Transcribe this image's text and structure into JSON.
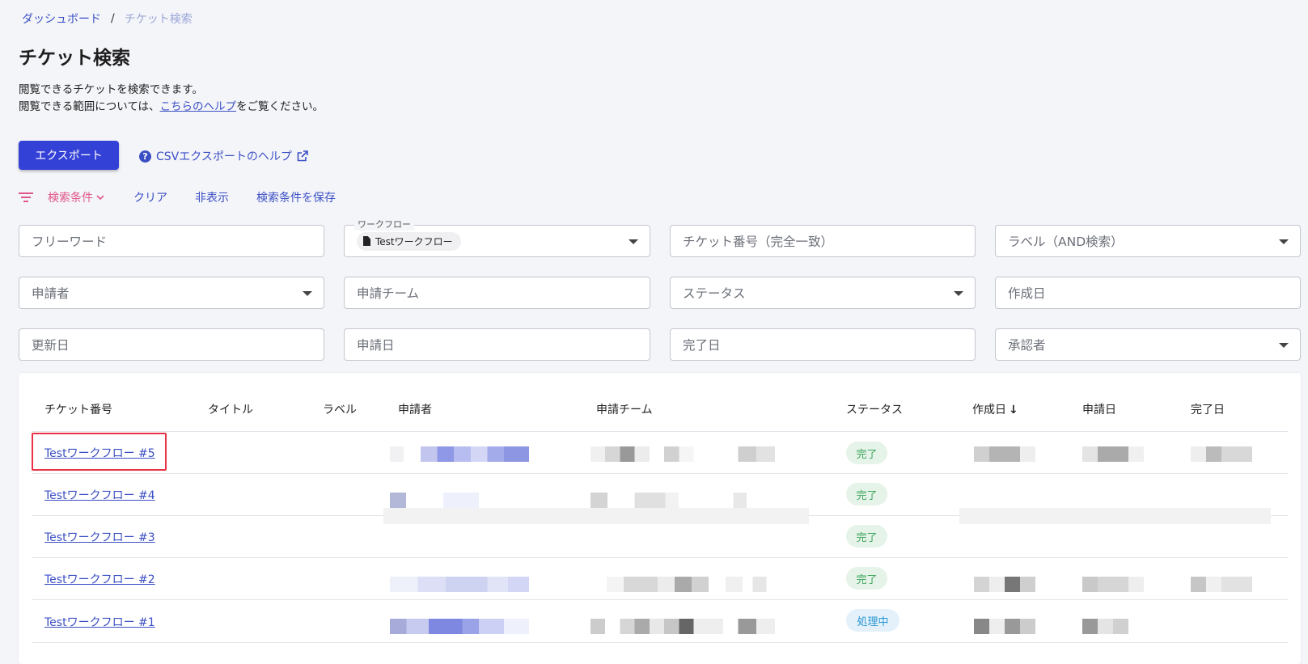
{
  "breadcrumb": {
    "home": "ダッシュボード",
    "separator": "/",
    "current": "チケット検索"
  },
  "page": {
    "title": "チケット検索",
    "desc_line1": "閲覧できるチケットを検索できます。",
    "desc_line2_pre": "閲覧できる範囲については、",
    "desc_line2_link": "こちらのヘルプ",
    "desc_line2_post": "をご覧ください。"
  },
  "toolbar": {
    "export_label": "エクスポート",
    "csv_help_label": "CSVエクスポートのヘルプ"
  },
  "filter_bar": {
    "conditions": "検索条件",
    "clear": "クリア",
    "hide": "非表示",
    "save": "検索条件を保存"
  },
  "fields": {
    "freeword": "フリーワード",
    "workflow_legend": "ワークフロー",
    "workflow_value": "Testワークフロー",
    "ticket_number": "チケット番号（完全一致）",
    "label": "ラベル（AND検索）",
    "applicant": "申請者",
    "applicant_team": "申請チーム",
    "status": "ステータス",
    "created_date": "作成日",
    "updated_date": "更新日",
    "applied_date": "申請日",
    "completed_date": "完了日",
    "approver": "承認者"
  },
  "table": {
    "headers": {
      "ticket_no": "チケット番号",
      "title": "タイトル",
      "label": "ラベル",
      "applicant": "申請者",
      "team": "申請チーム",
      "status": "ステータス",
      "created": "作成日",
      "sort_arrow": "↓",
      "applied": "申請日",
      "completed": "完了日"
    },
    "rows": [
      {
        "ticket": "Testワークフロー #5",
        "status": "完了"
      },
      {
        "ticket": "Testワークフロー #4",
        "status": "完了"
      },
      {
        "ticket": "Testワークフロー #3",
        "status": "完了"
      },
      {
        "ticket": "Testワークフロー #2",
        "status": "完了"
      },
      {
        "ticket": "Testワークフロー #1",
        "status": "処理中"
      }
    ]
  },
  "colors": {
    "primary": "#3441d6",
    "link": "#3b4fc4",
    "filter_accent": "#e0568a",
    "highlight": "#e83346",
    "status_done": "#3ca55c",
    "status_processing": "#2796d2"
  },
  "icons": [
    "filter-icon",
    "chevron-down-icon",
    "help-icon",
    "external-link-icon",
    "document-icon",
    "dropdown-caret-icon",
    "sort-down-icon"
  ]
}
